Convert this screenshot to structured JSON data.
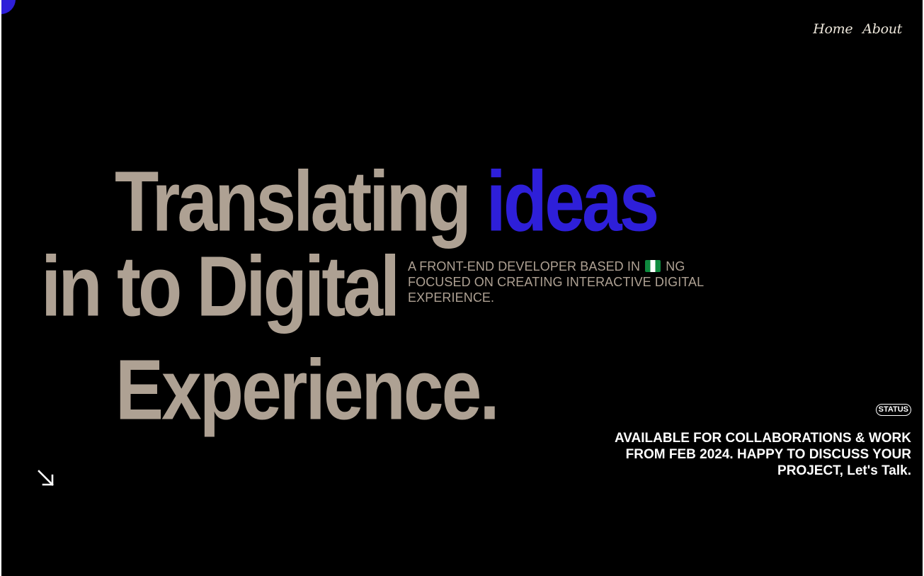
{
  "nav": {
    "items": [
      {
        "label": "Home"
      },
      {
        "label": "About"
      }
    ]
  },
  "hero": {
    "line1_main": "Translating",
    "line1_accent": "ideas",
    "line2": "in to Digital",
    "line3": "Experience.",
    "intro_before_flag": "A FRONT-END DEVELOPER BASED IN",
    "intro_after_flag": "NG FOCUSED ON CREATING INTERACTIVE DIGITAL EXPERIENCE."
  },
  "status": {
    "badge": "STATUS",
    "text": "AVAILABLE FOR COLLABORATIONS & WORK FROM FEB 2024. HAPPY TO DISCUSS YOUR PROJECT, Let's Talk."
  },
  "icons": {
    "scroll": "arrow-down-right-icon",
    "flag": "nigeria-flag-icon"
  },
  "colors": {
    "background": "#000000",
    "headline": "#aea193",
    "accent": "#2e1fd9",
    "text_light": "#ffffff"
  }
}
